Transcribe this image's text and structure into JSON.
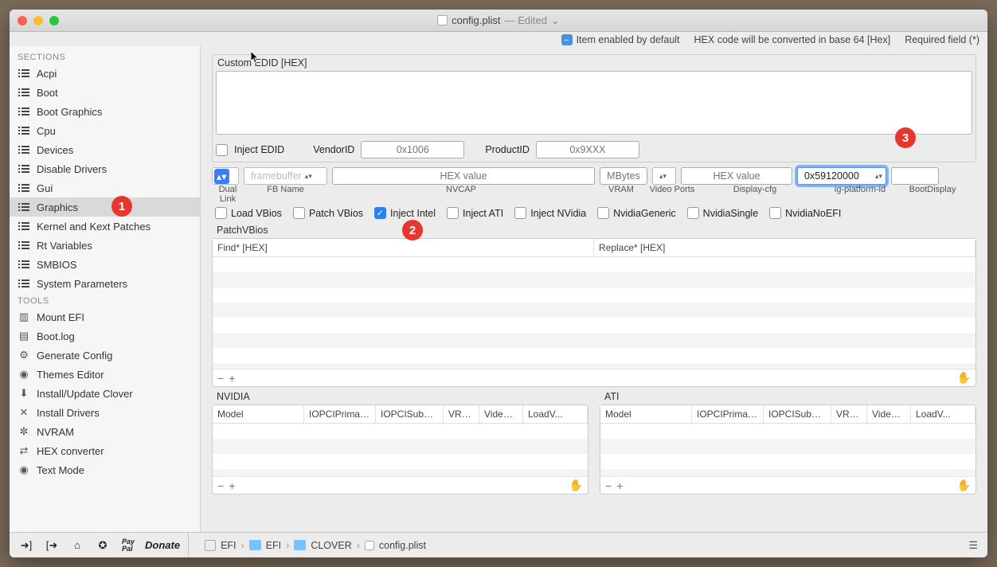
{
  "title": {
    "filename": "config.plist",
    "status": "— Edited",
    "chevron": "⌄"
  },
  "header_hints": {
    "enabled": "Item enabled by default",
    "hex": "HEX code will be converted in base 64 [Hex]",
    "required": "Required field (*)"
  },
  "sidebar": {
    "sections_label": "SECTIONS",
    "tools_label": "TOOLS",
    "sections": [
      "Acpi",
      "Boot",
      "Boot Graphics",
      "Cpu",
      "Devices",
      "Disable Drivers",
      "Gui",
      "Graphics",
      "Kernel and Kext Patches",
      "Rt Variables",
      "SMBIOS",
      "System Parameters"
    ],
    "tools": [
      "Mount EFI",
      "Boot.log",
      "Generate Config",
      "Themes Editor",
      "Install/Update Clover",
      "Install Drivers",
      "NVRAM",
      "HEX converter",
      "Text Mode"
    ]
  },
  "edid": {
    "section_title": "Custom EDID [HEX]",
    "inject_label": "Inject EDID",
    "vendor_label": "VendorID",
    "vendor_ph": "0x1006",
    "product_label": "ProductID",
    "product_ph": "0x9XXX"
  },
  "fields": {
    "dual_link": "Dual Link",
    "fbname_ph": "framebuffer",
    "fbname_hint": "FB Name",
    "nvcap_ph": "HEX value",
    "nvcap_hint": "NVCAP",
    "mbytes_ph": "MBytes",
    "vram_hint": "VRAM",
    "videoports_hint": "Video Ports",
    "displaycfg_ph": "HEX value",
    "displaycfg_hint": "Display-cfg",
    "igplatform_val": "0x59120000",
    "igplatform_hint": "ig-platform-id",
    "bootdisplay_hint": "BootDisplay"
  },
  "inject": {
    "load_vbios": "Load VBios",
    "patch_vbios": "Patch VBios",
    "inject_intel": "Inject Intel",
    "inject_ati": "Inject ATI",
    "inject_nvidia": "Inject NVidia",
    "nvidia_generic": "NvidiaGeneric",
    "nvidia_single": "NvidiaSingle",
    "nvidia_noefi": "NvidiaNoEFI"
  },
  "patchvbios": {
    "label": "PatchVBios",
    "find_col": "Find* [HEX]",
    "replace_col": "Replace* [HEX]"
  },
  "nvidia": {
    "label": "NVIDIA",
    "cols": [
      "Model",
      "IOPCIPrimarv...",
      "IOPCISubD...",
      "VRAM",
      "VideoP...",
      "LoadV..."
    ]
  },
  "ati": {
    "label": "ATI",
    "cols": [
      "Model",
      "IOPCIPrimarv...",
      "IOPCISubD...",
      "VRAM",
      "VideoP...",
      "LoadV..."
    ]
  },
  "breadcrumb": [
    "EFI",
    "EFI",
    "CLOVER",
    "config.plist"
  ],
  "donate": "Donate",
  "paypal": "Pay\nPal",
  "badges": {
    "b1": "1",
    "b2": "2",
    "b3": "3"
  },
  "minus": "−",
  "plus": "+",
  "grab": "✋"
}
